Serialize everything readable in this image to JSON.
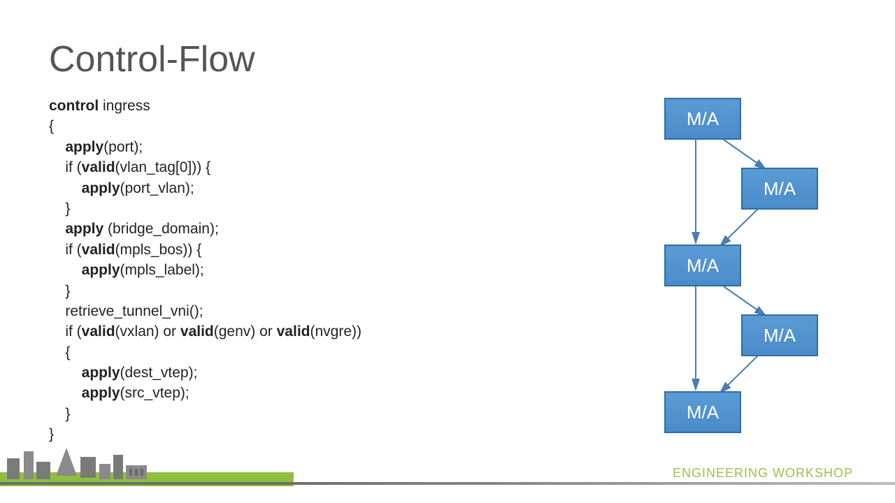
{
  "title": "Control-Flow",
  "code": {
    "l0a": "control",
    "l0b": " ingress",
    "l1": "{",
    "l2a": "    apply",
    "l2b": "(port);",
    "l3a": "    if (",
    "l3b": "valid",
    "l3c": "(vlan_tag[0])) {",
    "l4a": "        apply",
    "l4b": "(port_vlan);",
    "l5": "    }",
    "l6a": "    apply",
    "l6b": " (bridge_domain);",
    "l7a": "    if (",
    "l7b": "valid",
    "l7c": "(mpls_bos)) {",
    "l8a": "        apply",
    "l8b": "(mpls_label);",
    "l9": "    }",
    "l10": "    retrieve_tunnel_vni();",
    "l11a": "    if (",
    "l11b": "valid",
    "l11c": "(vxlan) or ",
    "l11d": "valid",
    "l11e": "(genv) or ",
    "l11f": "valid",
    "l11g": "(nvgre))",
    "l12": "    {",
    "l13a": "        apply",
    "l13b": "(dest_vtep);",
    "l14a": "        apply",
    "l14b": "(src_vtep);",
    "l15": "    }",
    "l16": "}"
  },
  "diagram": {
    "box1": "M/A",
    "box2": "M/A",
    "box3": "M/A",
    "box4": "M/A",
    "box5": "M/A"
  },
  "footer": "ENGINEERING WORKSHOP"
}
